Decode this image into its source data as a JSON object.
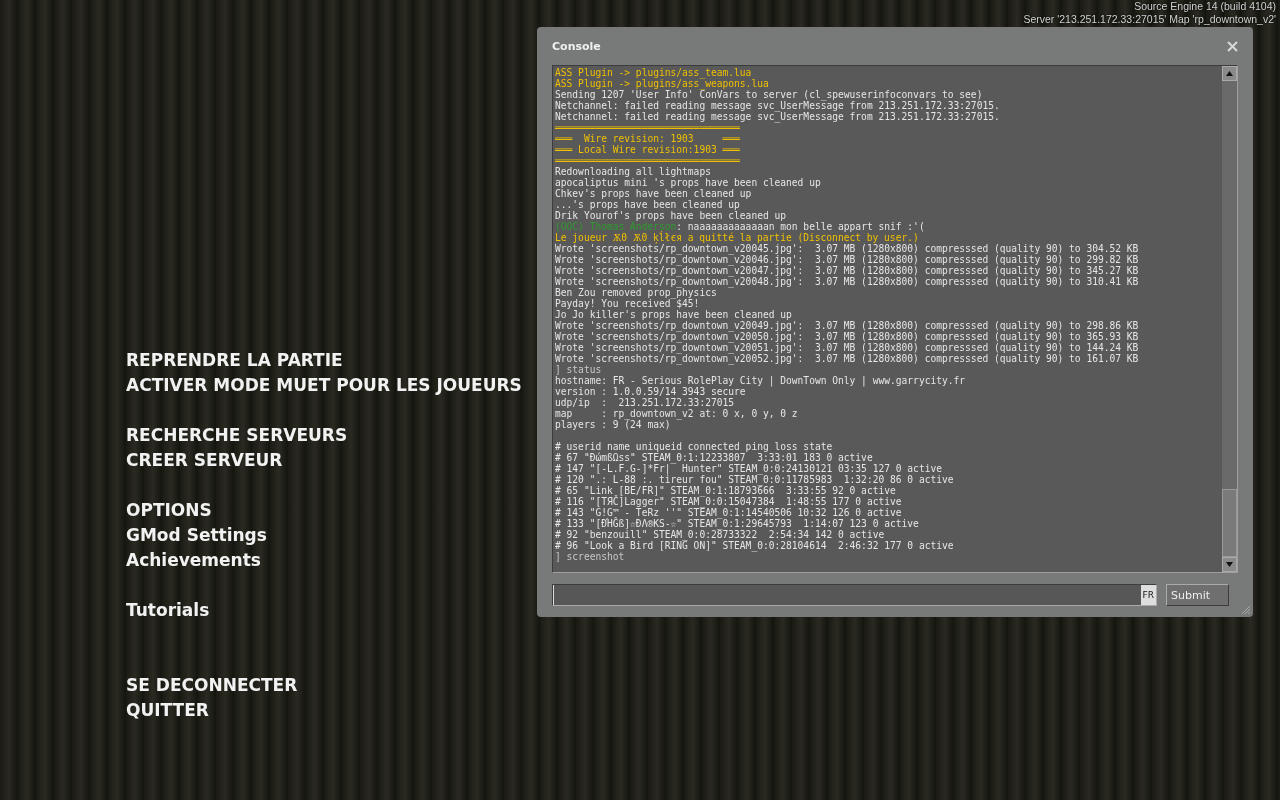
{
  "engine_info": {
    "build": "Source Engine 14 (build 4104)",
    "server": "Server '213.251.172.33:27015' Map 'rp_downtown_v2'"
  },
  "menu": [
    [
      {
        "label": "REPRENDRE LA PARTIE"
      },
      {
        "label": "ACTIVER MODE MUET POUR LES JOUEURS"
      }
    ],
    [
      {
        "label": "RECHERCHE SERVEURS"
      },
      {
        "label": "CREER SERVEUR"
      }
    ],
    [
      {
        "label": "OPTIONS"
      },
      {
        "label": "GMod Settings"
      },
      {
        "label": "Achievements"
      }
    ],
    [
      {
        "label": "Tutorials"
      }
    ],
    [
      {
        "label": "SE DECONNECTER"
      },
      {
        "label": "QUITTER"
      }
    ]
  ],
  "console": {
    "title": "Console",
    "lines": [
      {
        "kind": "notice",
        "text": "ASS Plugin -> plugins/ass_team.lua"
      },
      {
        "kind": "notice",
        "text": "ASS Plugin -> plugins/ass_weapons.lua"
      },
      {
        "kind": "plain",
        "text": "Sending 1207 'User Info' ConVars to server (cl_spewuserinfoconvars to see)"
      },
      {
        "kind": "plain",
        "text": "Netchannel: failed reading message svc_UserMessage from 213.251.172.33:27015."
      },
      {
        "kind": "plain",
        "text": "Netchannel: failed reading message svc_UserMessage from 213.251.172.33:27015."
      },
      {
        "kind": "notice",
        "text": "════════════════════════════════"
      },
      {
        "kind": "notice",
        "text": "═══  Wire revision: 1903     ═══"
      },
      {
        "kind": "notice",
        "text": "═══ Local Wire revision:1903 ═══"
      },
      {
        "kind": "notice",
        "text": "════════════════════════════════"
      },
      {
        "kind": "plain",
        "text": "Redownloading all lightmaps"
      },
      {
        "kind": "plain",
        "text": "apocaliptus mini 's props have been cleaned up"
      },
      {
        "kind": "plain",
        "text": "Chkev's props have been cleaned up"
      },
      {
        "kind": "plain",
        "text": "...'s props have been cleaned up"
      },
      {
        "kind": "plain",
        "text": "Drik Yourof's props have been cleaned up"
      },
      {
        "kind": "chat",
        "speaker": "(OOC) Thomas Anderson",
        "text": ": naaaaaaaaaaaaan mon belle appart snif :'("
      },
      {
        "kind": "notice",
        "text": "Le joueur Ѫ0 Ѫ0 ķĺłєя a quitté la partie (Disconnect by user.)"
      },
      {
        "kind": "plain",
        "text": "Wrote 'screenshots/rp_downtown_v20045.jpg':  3.07 MB (1280x800) compresssed (quality 90) to 304.52 KB"
      },
      {
        "kind": "plain",
        "text": "Wrote 'screenshots/rp_downtown_v20046.jpg':  3.07 MB (1280x800) compresssed (quality 90) to 299.82 KB"
      },
      {
        "kind": "plain",
        "text": "Wrote 'screenshots/rp_downtown_v20047.jpg':  3.07 MB (1280x800) compresssed (quality 90) to 345.27 KB"
      },
      {
        "kind": "plain",
        "text": "Wrote 'screenshots/rp_downtown_v20048.jpg':  3.07 MB (1280x800) compresssed (quality 90) to 310.41 KB"
      },
      {
        "kind": "plain",
        "text": "Ben Zou removed prop_physics"
      },
      {
        "kind": "plain",
        "text": "Payday! You received $45!"
      },
      {
        "kind": "plain",
        "text": "Jo Jo killer's props have been cleaned up"
      },
      {
        "kind": "plain",
        "text": "Wrote 'screenshots/rp_downtown_v20049.jpg':  3.07 MB (1280x800) compresssed (quality 90) to 298.86 KB"
      },
      {
        "kind": "plain",
        "text": "Wrote 'screenshots/rp_downtown_v20050.jpg':  3.07 MB (1280x800) compresssed (quality 90) to 365.93 KB"
      },
      {
        "kind": "plain",
        "text": "Wrote 'screenshots/rp_downtown_v20051.jpg':  3.07 MB (1280x800) compresssed (quality 90) to 144.24 KB"
      },
      {
        "kind": "plain",
        "text": "Wrote 'screenshots/rp_downtown_v20052.jpg':  3.07 MB (1280x800) compresssed (quality 90) to 161.07 KB"
      },
      {
        "kind": "echo",
        "text": "] status"
      },
      {
        "kind": "plain",
        "text": "hostname: FR - Serious RolePlay City | DownTown Only | www.garrycity.fr"
      },
      {
        "kind": "plain",
        "text": "version : 1.0.0.59/14 3943 secure"
      },
      {
        "kind": "plain",
        "text": "udp/ip  :  213.251.172.33:27015"
      },
      {
        "kind": "plain",
        "text": "map     : rp_downtown_v2 at: 0 x, 0 y, 0 z"
      },
      {
        "kind": "plain",
        "text": "players : 9 (24 max)"
      },
      {
        "kind": "blank"
      },
      {
        "kind": "plain",
        "text": "# userid name uniqueid connected ping loss state"
      },
      {
        "kind": "plain",
        "text": "# 67 \"ĐώmßΩss\" STEAM_0:1:12233807  3:33:01 183 0 active"
      },
      {
        "kind": "plain",
        "text": "# 147 \"[-L.F.G-]*Fr|  Hunter\" STEAM_0:0:24130121 03:35 127 0 active"
      },
      {
        "kind": "plain",
        "text": "# 120 \".: L-88 :. tireur fou\" STEAM_0:0:11785983  1:32:20 86 0 active"
      },
      {
        "kind": "plain",
        "text": "# 65 \"Link [BE/FR]\" STEAM_0:1:18793666  3:33:55 92 0 active"
      },
      {
        "kind": "plain",
        "text": "# 116 \"[TЯČ]Lagger\" STEAM_0:0:15047384  1:48:55 177 0 active"
      },
      {
        "kind": "plain",
        "text": "# 143 \"G!G™ - TeRz ''\" STEAM_0:1:14540506 10:32 126 0 active"
      },
      {
        "kind": "plain",
        "text": "# 133 \"[ĐΉĜß]☆ĐΛ®KS-☆\" STEAM_0:1:29645793  1:14:07 123 0 active"
      },
      {
        "kind": "plain",
        "text": "# 92 \"benzouill\" STEAM_0:0:28733322  2:54:34 142 0 active"
      },
      {
        "kind": "plain",
        "text": "# 96 \"Look a Bird [RING ON]\" STEAM_0:0:28104614  2:46:32 177 0 active"
      },
      {
        "kind": "echo",
        "text": "] screenshot"
      }
    ],
    "input": {
      "language": "FR"
    },
    "submit": "Submit"
  }
}
